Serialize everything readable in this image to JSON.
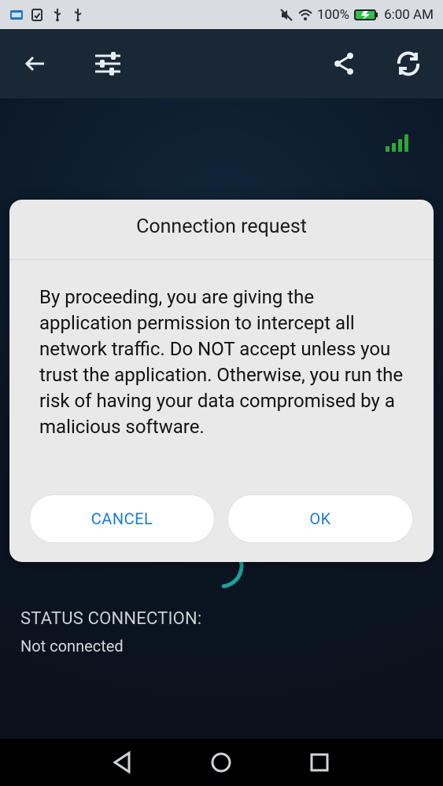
{
  "status_bar": {
    "battery_text": "100%",
    "time_text": "6:00 AM",
    "left_icons": [
      "image-icon",
      "clipboard-check-icon",
      "usb-icon",
      "usb-icon"
    ],
    "right_icons": [
      "mute-icon",
      "wifi-icon",
      "battery-charging-icon"
    ],
    "colors": {
      "battery_fill": "#2fbf4d"
    }
  },
  "app_bar": {
    "icons": [
      "back-arrow-icon",
      "sliders-icon",
      "share-icon",
      "refresh-icon"
    ]
  },
  "signal": {
    "icon": "signal-bars-icon",
    "color": "#2fa53b"
  },
  "dialog": {
    "title": "Connection request",
    "message": "By proceeding, you are giving the application permission to intercept all network traffic. Do NOT accept unless you trust the application. Otherwise, you run the risk of having your data compromised by a malicious software.",
    "cancel_label": "CANCEL",
    "ok_label": "OK",
    "accent": "#1c7bd6"
  },
  "status": {
    "label": "STATUS CONNECTION:",
    "value": "Not connected"
  },
  "spinner": {
    "color": "#1aa39a"
  },
  "nav": {
    "icons": [
      "nav-back-icon",
      "nav-home-icon",
      "nav-recents-icon"
    ]
  }
}
